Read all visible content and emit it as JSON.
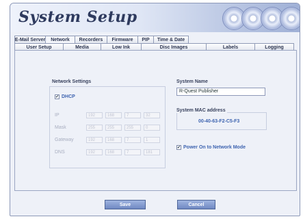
{
  "app": {
    "title": "System Setup"
  },
  "tabs": {
    "row_back": [
      "E-Mail Server",
      "Network",
      "Recorders",
      "Firmware",
      "PIP",
      "Time & Date"
    ],
    "row_front": [
      "User Setup",
      "Media",
      "Low Ink",
      "Disc Images",
      "Labels",
      "Logging"
    ],
    "active": "Network"
  },
  "network": {
    "title": "Network Settings",
    "dhcp_label": "DHCP",
    "dhcp_checked": true,
    "fields": [
      {
        "label": "IP",
        "octets": [
          "192",
          "168",
          "7",
          "32"
        ]
      },
      {
        "label": "Mask",
        "octets": [
          "255",
          "255",
          "255",
          "0"
        ]
      },
      {
        "label": "Gateway",
        "octets": [
          "192",
          "168",
          "7",
          "1"
        ]
      },
      {
        "label": "DNS",
        "octets": [
          "192",
          "168",
          "7",
          "181"
        ]
      }
    ]
  },
  "system_name": {
    "title": "System Name",
    "value": "R-Quest Publisher"
  },
  "mac": {
    "title": "System MAC address",
    "value": "00-40-63-F2-C5-F3"
  },
  "power_on": {
    "label": "Power On to Network Mode",
    "checked": true
  },
  "buttons": {
    "save": "Save",
    "cancel": "Cancel"
  }
}
